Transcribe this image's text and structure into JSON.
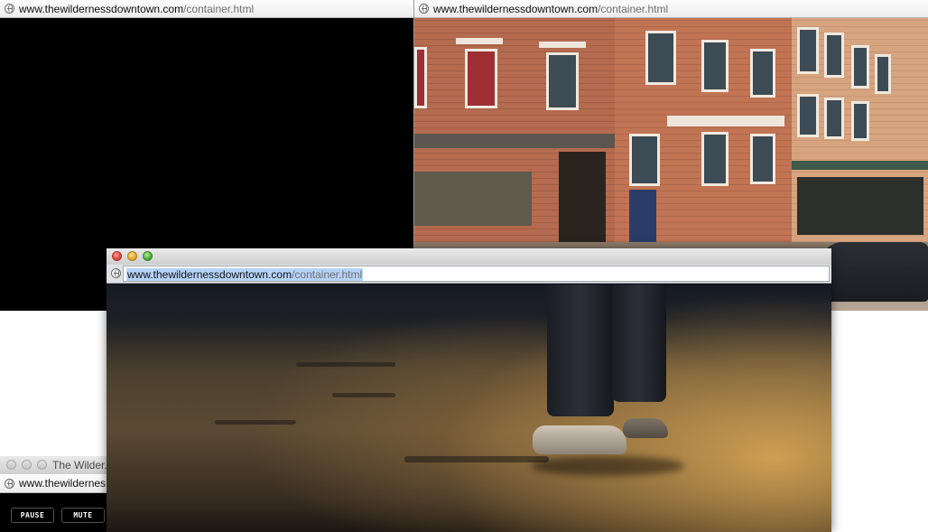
{
  "window_a": {
    "url_domain": "www.thewildernessdowntown.com",
    "url_path": "/container.html"
  },
  "window_b": {
    "url_domain": "www.thewildernessdowntown.com",
    "url_path": "/container.html"
  },
  "window_c": {
    "url_domain": "www.thewildernessdowntown.com",
    "url_path": "/container.html",
    "url_selected": true
  },
  "window_d": {
    "title": "The Wilder...",
    "url_text": "www.thewildernes...",
    "pause_label": "PAUSE",
    "mute_label": "MUTE"
  },
  "icons": {
    "address_icon": "globe-icon",
    "close": "close-button",
    "minimize": "minimize-button",
    "zoom": "zoom-button"
  },
  "colors": {
    "close_red": "#e0443a",
    "minimize_yellow": "#e3a72a",
    "zoom_green": "#4caa3a",
    "selection": "#b5d3f8"
  }
}
